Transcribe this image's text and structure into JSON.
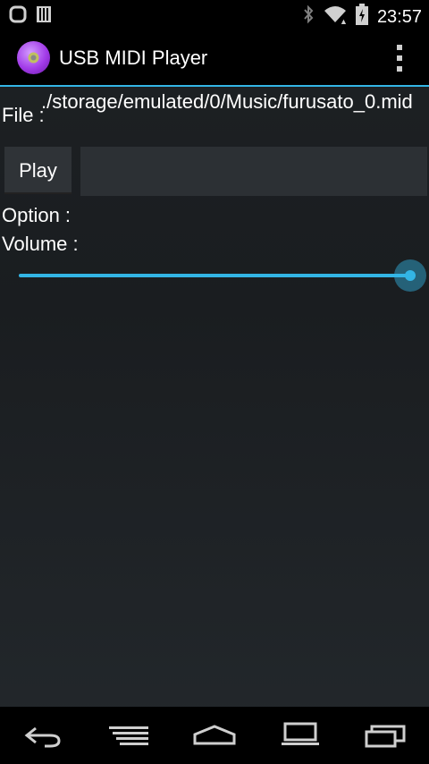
{
  "status_bar": {
    "time": "23:57",
    "icons": [
      "notification-ring-icon",
      "storage-icon",
      "bluetooth-icon",
      "wifi-icon",
      "battery-charging-icon"
    ]
  },
  "action_bar": {
    "app_title": "USB MIDI Player",
    "app_icon": "app-icon",
    "overflow_icon": "overflow-menu-icon"
  },
  "main": {
    "file_label": "File :",
    "file_path": "./storage/emulated/0/Music/furusato_0.mid",
    "play_label": "Play",
    "input_value": "",
    "option_label": "Option :",
    "volume_label": "Volume :",
    "volume_level": 1.0
  },
  "nav_bar": {
    "buttons": [
      "back-icon",
      "menu-icon",
      "home-icon",
      "screen-icon",
      "recent-apps-icon"
    ]
  },
  "colors": {
    "accent": "#33b5e5",
    "background": "#1d2124"
  }
}
